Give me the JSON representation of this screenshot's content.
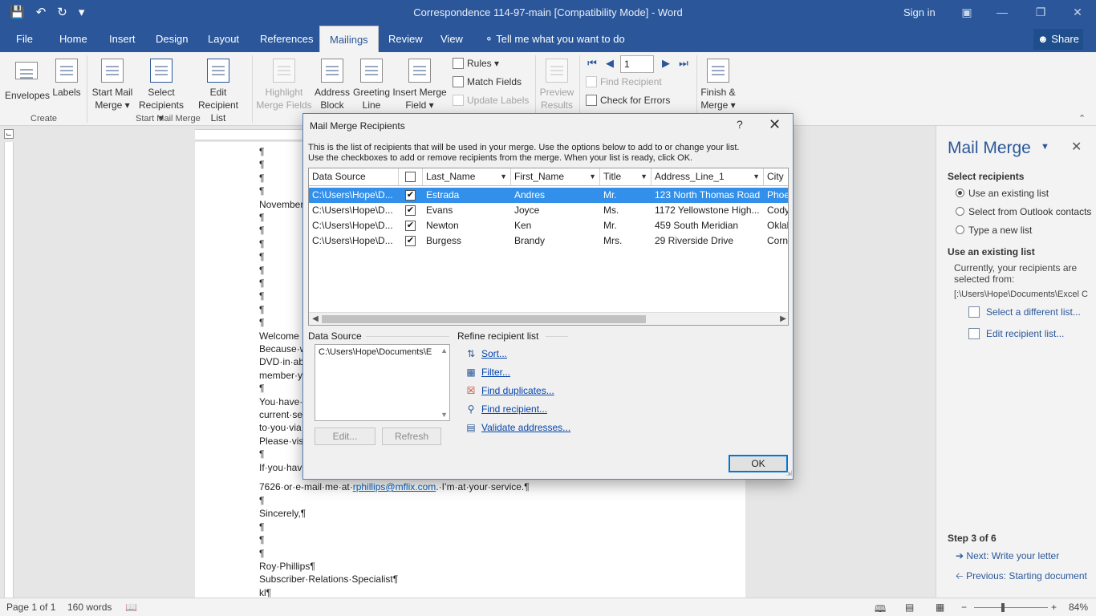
{
  "window": {
    "title": "Correspondence 114-97-main [Compatibility Mode]  -  Word",
    "signin": "Sign in"
  },
  "tabs": [
    "File",
    "Home",
    "Insert",
    "Design",
    "Layout",
    "References",
    "Mailings",
    "Review",
    "View"
  ],
  "active_tab": "Mailings",
  "tellme": "Tell me what you want to do",
  "share": "Share",
  "ribbon": {
    "envelopes": "Envelopes",
    "labels": "Labels",
    "start_mail_merge": [
      "Start Mail",
      "Merge ▾"
    ],
    "select_recipients": [
      "Select",
      "Recipients ▾"
    ],
    "edit_recipient_list": [
      "Edit",
      "Recipient List"
    ],
    "highlight_merge_fields": [
      "Highlight",
      "Merge Fields"
    ],
    "address_block": [
      "Address",
      "Block"
    ],
    "greeting_line": [
      "Greeting",
      "Line"
    ],
    "insert_merge_field": [
      "Insert Merge",
      "Field ▾"
    ],
    "rules": "Rules ▾",
    "match_fields": "Match Fields",
    "update_labels": "Update Labels",
    "preview_results": [
      "Preview",
      "Results"
    ],
    "record_number": "1",
    "find_recipient": "Find Recipient",
    "check_for_errors": "Check for Errors",
    "finish_merge": [
      "Finish &",
      "Merge ▾"
    ],
    "group_create": "Create",
    "group_start": "Start Mail Merge"
  },
  "document": {
    "lines": [
      "¶",
      "¶",
      "¶",
      "¶",
      "November",
      "¶",
      "¶",
      "¶",
      "¶",
      "¶",
      "¶",
      "¶",
      "¶",
      "¶",
      "Welcome",
      "Because·w",
      "DVD·in·ab",
      "member·y",
      "¶",
      "You·have·",
      "current·se",
      "to·you·via",
      "Please·vis",
      "¶",
      "If·you·hav"
    ],
    "email_line_prefix": "7626·or·e-mail·me·at·",
    "email": "rphillips@mflix.com",
    "email_line_suffix": ".·I’m·at·your·service.¶",
    "closing": [
      "¶",
      "Sincerely,¶",
      "¶",
      "¶",
      "¶",
      "Roy·Phillips¶",
      "Subscriber·Relations·Specialist¶",
      "kl¶"
    ]
  },
  "pane": {
    "title": "Mail Merge",
    "select_recipients": "Select recipients",
    "options": [
      "Use an existing list",
      "Select from Outlook contacts",
      "Type a new list"
    ],
    "use_existing_heading": "Use an existing list",
    "currently_text": "Currently, your recipients are selected from:",
    "path": "[:\\Users\\Hope\\Documents\\Excel C",
    "select_different": "Select a different list...",
    "edit_list": "Edit recipient list...",
    "step": "Step 3 of 6",
    "next": "Next: Write your letter",
    "previous": "Previous: Starting document"
  },
  "status": {
    "page": "Page 1 of 1",
    "words": "160 words",
    "zoom": "84%"
  },
  "dialog": {
    "title": "Mail Merge Recipients",
    "intro_1": "This is the list of recipients that will be used in your merge.  Use the options below to add to or change your list.",
    "intro_2": "Use the checkboxes to add or remove recipients from the merge.  When your list is ready, click OK.",
    "columns": [
      "Data Source",
      "",
      "Last_Name",
      "First_Name",
      "Title",
      "Address_Line_1",
      "City"
    ],
    "rows": [
      {
        "source": "C:\\Users\\Hope\\D...",
        "last": "Estrada",
        "first": "Andres",
        "title": "Mr.",
        "address": "123 North Thomas Road",
        "city": "Phoe"
      },
      {
        "source": "C:\\Users\\Hope\\D...",
        "last": "Evans",
        "first": "Joyce",
        "title": "Ms.",
        "address": "1172 Yellowstone High...",
        "city": "Cody"
      },
      {
        "source": "C:\\Users\\Hope\\D...",
        "last": "Newton",
        "first": "Ken",
        "title": "Mr.",
        "address": "459 South Meridian",
        "city": "Oklah"
      },
      {
        "source": "C:\\Users\\Hope\\D...",
        "last": "Burgess",
        "first": "Brandy",
        "title": "Mrs.",
        "address": "29 Riverside Drive",
        "city": "Corn"
      }
    ],
    "data_source_label": "Data Source",
    "data_source_value": "C:\\Users\\Hope\\Documents\\E",
    "edit": "Edit...",
    "refresh": "Refresh",
    "refine_label": "Refine recipient list",
    "refine": [
      "Sort...",
      "Filter...",
      "Find duplicates...",
      "Find recipient...",
      "Validate addresses..."
    ],
    "ok": "OK"
  }
}
